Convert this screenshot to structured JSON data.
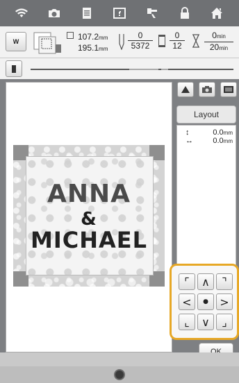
{
  "topbar": {
    "icons": [
      "wifi-icon",
      "camera-icon",
      "document-icon",
      "help-icon",
      "thread-icon",
      "lock-icon",
      "home-icon"
    ]
  },
  "info": {
    "w_label": "W",
    "width_value": "107.2",
    "height_value": "195.1",
    "size_unit": "mm",
    "stitch_num": "0",
    "stitch_den": "5372",
    "color_num": "0",
    "color_den": "12",
    "time_num": "0",
    "time_den": "20",
    "time_unit": "min"
  },
  "progress": {
    "fill": 0.0
  },
  "design": {
    "line1": "ANNA",
    "line2": "&",
    "line3": "MICHAEL"
  },
  "panel": {
    "layout_label": "Layout",
    "offset_vertical": "0.0",
    "offset_horizontal": "0.0",
    "offset_unit": "mm",
    "vertical_arrow": "↕",
    "horizontal_arrow": "↔"
  },
  "arrows": {
    "up_left": "⌜",
    "up": "∧",
    "up_right": "⌝",
    "left": "<",
    "center": "●",
    "right": ">",
    "down_left": "⌞",
    "down": "∨",
    "down_right": "⌟"
  },
  "ok_label": "OK",
  "colors": {
    "highlight": "#e7a826",
    "topbar": "#6f7174"
  }
}
